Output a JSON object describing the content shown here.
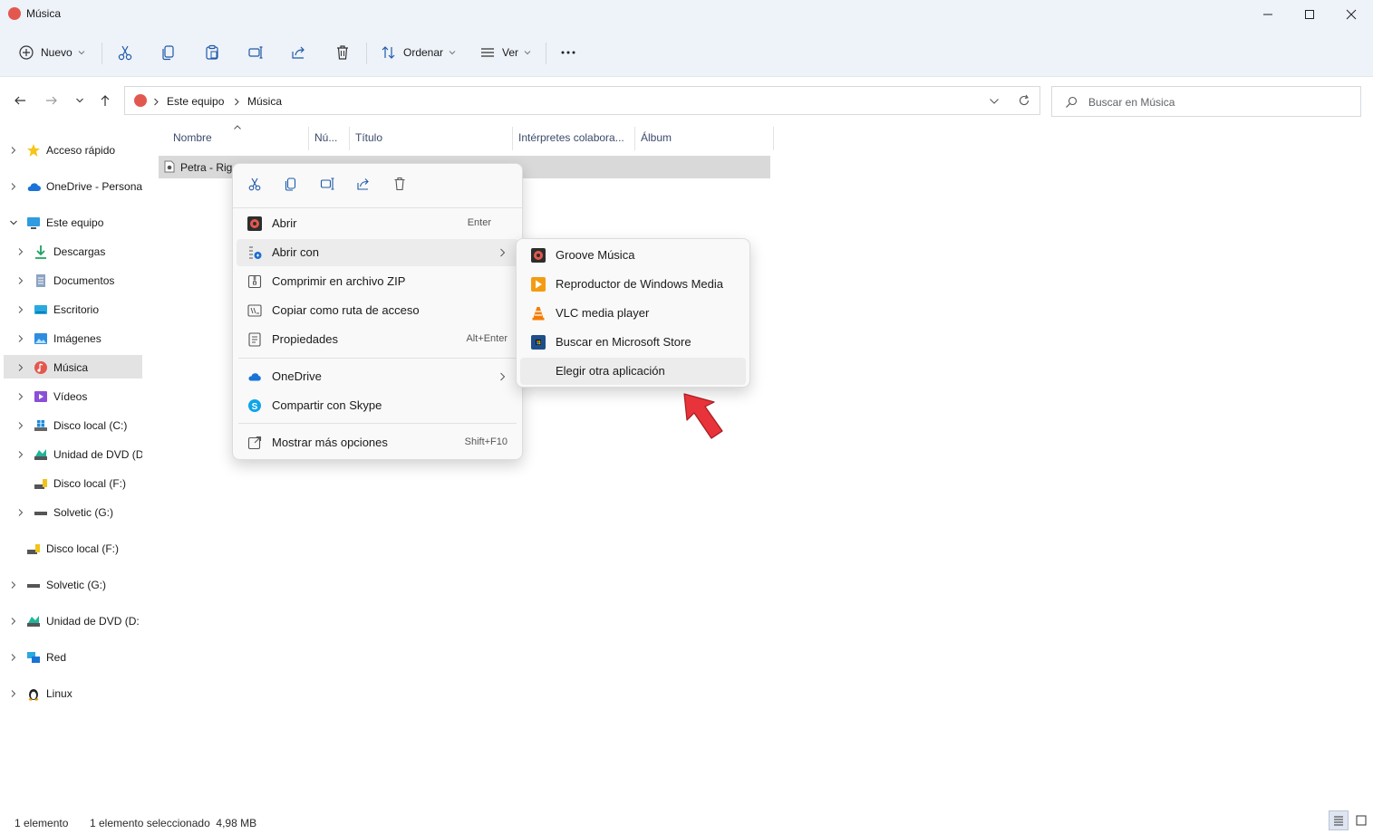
{
  "window": {
    "title": "Música"
  },
  "toolbar": {
    "new_label": "Nuevo",
    "sort_label": "Ordenar",
    "view_label": "Ver"
  },
  "address": {
    "crumbs": [
      "Este equipo",
      "Música"
    ],
    "search_placeholder": "Buscar en Música"
  },
  "sidebar": {
    "items": [
      {
        "label": "Acceso rápido",
        "icon": "star-icon"
      },
      {
        "label": "OneDrive - Persona",
        "icon": "cloud-icon"
      },
      {
        "label": "Este equipo",
        "icon": "monitor-icon"
      },
      {
        "label": "Descargas",
        "icon": "download-icon"
      },
      {
        "label": "Documentos",
        "icon": "document-icon"
      },
      {
        "label": "Escritorio",
        "icon": "desktop-icon"
      },
      {
        "label": "Imágenes",
        "icon": "pictures-icon"
      },
      {
        "label": "Música",
        "icon": "music-icon"
      },
      {
        "label": "Vídeos",
        "icon": "videos-icon"
      },
      {
        "label": "Disco local (C:)",
        "icon": "windows-drive-icon"
      },
      {
        "label": "Unidad de DVD (D",
        "icon": "dvd-drive-icon"
      },
      {
        "label": "Disco local (F:)",
        "icon": "usb-drive-icon"
      },
      {
        "label": "Solvetic (G:)",
        "icon": "drive-icon"
      },
      {
        "label": "Disco local (F:)",
        "icon": "usb-drive-icon"
      },
      {
        "label": "Solvetic (G:)",
        "icon": "drive-icon"
      },
      {
        "label": "Unidad de DVD (D:",
        "icon": "dvd-drive-icon"
      },
      {
        "label": "Red",
        "icon": "network-icon"
      },
      {
        "label": "Linux",
        "icon": "linux-icon"
      }
    ]
  },
  "columns": [
    "Nombre",
    "Nú...",
    "Título",
    "Intérpretes colabora...",
    "Álbum"
  ],
  "files": [
    {
      "name": "Petra - Rig"
    }
  ],
  "context_menu": {
    "items": [
      {
        "label": "Abrir",
        "shortcut": "Enter"
      },
      {
        "label": "Abrir con",
        "shortcut": ""
      },
      {
        "label": "Comprimir en archivo ZIP",
        "shortcut": ""
      },
      {
        "label": "Copiar como ruta de acceso",
        "shortcut": ""
      },
      {
        "label": "Propiedades",
        "shortcut": "Alt+Enter"
      },
      {
        "label": "OneDrive",
        "shortcut": ""
      },
      {
        "label": "Compartir con Skype",
        "shortcut": ""
      },
      {
        "label": "Mostrar más opciones",
        "shortcut": "Shift+F10"
      }
    ]
  },
  "submenu": {
    "items": [
      {
        "label": "Groove Música"
      },
      {
        "label": "Reproductor de Windows Media"
      },
      {
        "label": "VLC media player"
      },
      {
        "label": "Buscar en Microsoft Store"
      },
      {
        "label": "Elegir otra aplicación"
      }
    ]
  },
  "status": {
    "count": "1 elemento",
    "selection": "1 elemento seleccionado  4,98 MB"
  },
  "colors": {
    "accent": "#0067c0",
    "selection": "#e3e3e3",
    "arrow": "#e8333a"
  }
}
